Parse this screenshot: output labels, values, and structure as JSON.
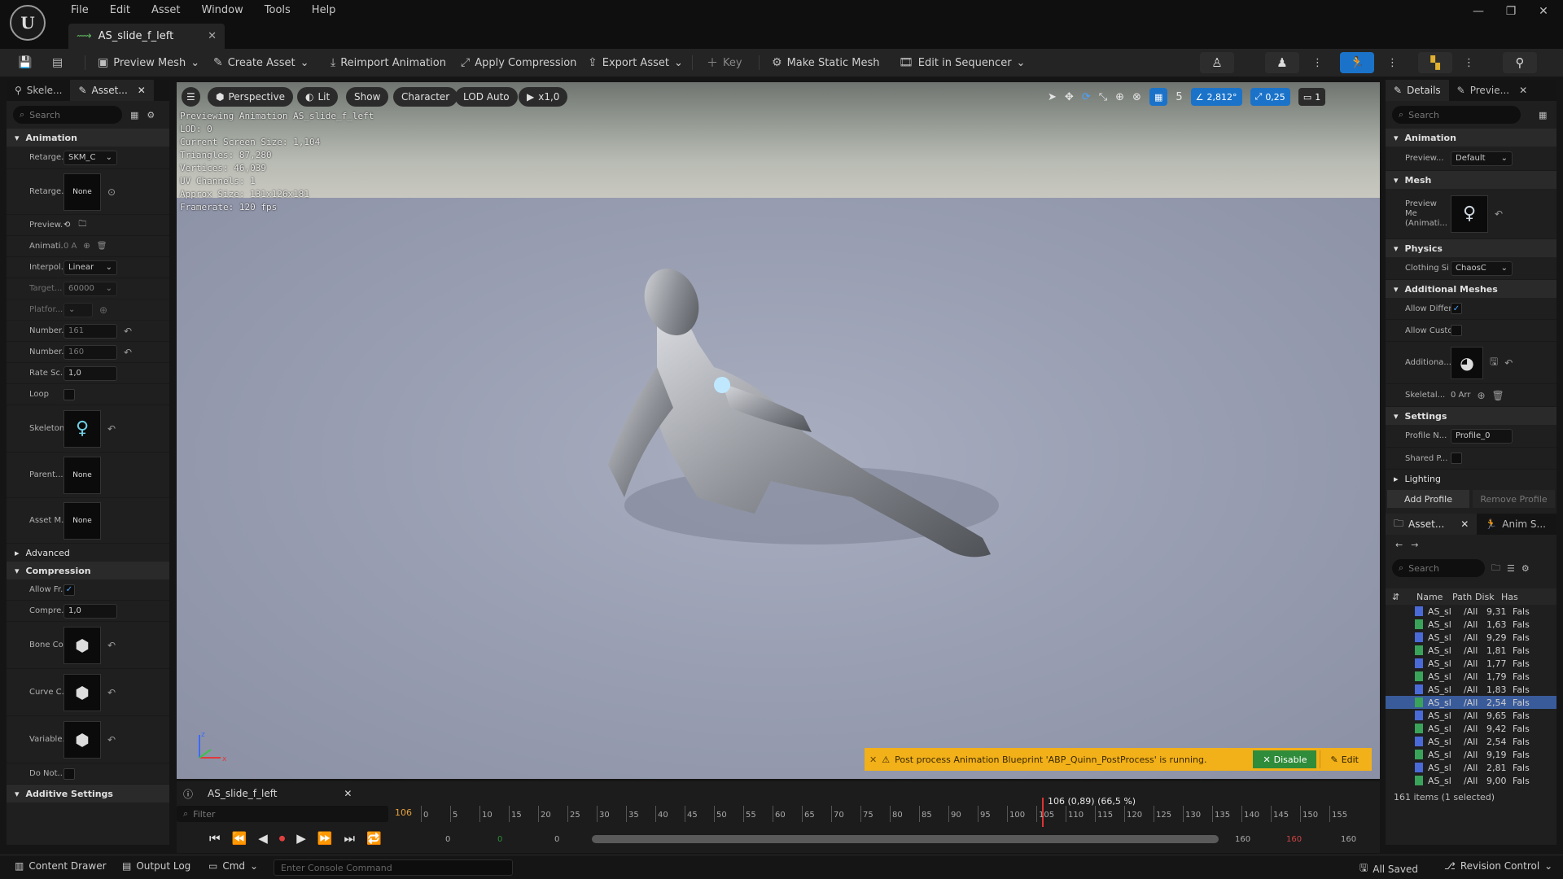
{
  "app": {
    "title": "Unreal Editor"
  },
  "menu": [
    "File",
    "Edit",
    "Asset",
    "Window",
    "Tools",
    "Help"
  ],
  "doc_tab": {
    "label": "AS_slide_f_left"
  },
  "toolbar": {
    "preview_mesh": "Preview Mesh",
    "create_asset": "Create Asset",
    "reimport": "Reimport Animation",
    "apply_compression": "Apply Compression",
    "export_asset": "Export Asset",
    "key": "Key",
    "make_static_mesh": "Make Static Mesh",
    "edit_in_sequencer": "Edit in Sequencer"
  },
  "left": {
    "tabs": [
      "Skele...",
      "Asset..."
    ],
    "search_placeholder": "Search",
    "animation_section": "Animation",
    "rows": [
      {
        "label": "Retarge...",
        "value": "SKM_C"
      },
      {
        "label": "Retarge...",
        "value": "None"
      },
      {
        "label": "Preview...",
        "value": ""
      },
      {
        "label": "Animati...",
        "value": "0 A"
      },
      {
        "label": "Interpol...",
        "value": "Linear"
      },
      {
        "label": "Target...",
        "value": "60000"
      },
      {
        "label": "Platfor...",
        "value": ""
      },
      {
        "label": "Number...",
        "value": "161"
      },
      {
        "label": "Number...",
        "value": "160"
      },
      {
        "label": "Rate Sc...",
        "value": "1,0"
      },
      {
        "label": "Loop",
        "value": ""
      },
      {
        "label": "Skeleton",
        "value": ""
      },
      {
        "label": "Parent...",
        "value": "None"
      },
      {
        "label": "Asset M...",
        "value": "None"
      }
    ],
    "advanced": "Advanced",
    "compression_section": "Compression",
    "compression_rows": [
      {
        "label": "Allow Fr...",
        "value": ""
      },
      {
        "label": "Compre...",
        "value": "1,0"
      },
      {
        "label": "Bone Co...",
        "value": ""
      },
      {
        "label": "Curve C...",
        "value": ""
      },
      {
        "label": "Variable...",
        "value": ""
      },
      {
        "label": "Do Not...",
        "value": ""
      }
    ],
    "additive_section": "Additive Settings"
  },
  "viewport": {
    "perspective": "Perspective",
    "lit": "Lit",
    "show": "Show",
    "character": "Character",
    "lod": "LOD Auto",
    "speed": "x1,0",
    "grid_count": "5",
    "angle": "2,812°",
    "scale": "0,25",
    "camera": "1",
    "stats": [
      "Previewing Animation AS_slide_f_left",
      "LOD: 0",
      "Current Screen Size: 1,104",
      "Triangles: 87,280",
      "Vertices: 46,039",
      "UV Channels: 1",
      "Approx Size: 131x126x181",
      "Framerate: 120 fps"
    ],
    "notification": "Post process Animation Blueprint 'ABP_Quinn_PostProcess' is running.",
    "disable": "Disable",
    "edit": "Edit"
  },
  "timeline": {
    "tab": "AS_slide_f_left",
    "filter_placeholder": "Filter",
    "frame_field": "106",
    "ticks": [
      "0",
      "5",
      "10",
      "15",
      "20",
      "25",
      "30",
      "35",
      "40",
      "45",
      "50",
      "55",
      "60",
      "65",
      "70",
      "75",
      "80",
      "85",
      "90",
      "95",
      "100",
      "105",
      "110",
      "115",
      "120",
      "125",
      "130",
      "135",
      "140",
      "145",
      "150",
      "155"
    ],
    "playhead_label": "106 (0,89) (66,5 %)",
    "playhead_fraction": 0.6625,
    "range_start": "0",
    "range_start2": "0",
    "range_end": "160",
    "range_end2": "160"
  },
  "right": {
    "tabs": [
      "Details",
      "Previe..."
    ],
    "search_placeholder": "Search",
    "sections": {
      "animation": "Animation",
      "mesh": "Mesh",
      "physics": "Physics",
      "additional_meshes": "Additional Meshes",
      "settings": "Settings",
      "lighting": "Lighting"
    },
    "preview_label": "Preview...",
    "preview_value": "Default",
    "preview_mesh_label": "Preview Me (Animati...",
    "clothing_label": "Clothing Si",
    "clothing_value": "ChaosC",
    "allow_diff": "Allow Differ",
    "allow_custom": "Allow Custo",
    "additional_label": "Additiona...",
    "skeletal_label": "Skeletal...",
    "skeletal_value": "0 Arr",
    "profile_label": "Profile N...",
    "profile_value": "Profile_0",
    "shared_label": "Shared P...",
    "add_profile": "Add Profile",
    "remove_profile": "Remove Profile",
    "asset_tabs": [
      "Asset...",
      "Anim S..."
    ],
    "asset_search": "Search",
    "columns": [
      "Name",
      "Path",
      "Disk",
      "Has"
    ],
    "rows": [
      {
        "name": "AS_sl",
        "path": "/All",
        "disk": "9,31",
        "has": "Fals"
      },
      {
        "name": "AS_sl",
        "path": "/All",
        "disk": "1,63",
        "has": "Fals"
      },
      {
        "name": "AS_sl",
        "path": "/All",
        "disk": "9,29",
        "has": "Fals"
      },
      {
        "name": "AS_sl",
        "path": "/All",
        "disk": "1,81",
        "has": "Fals"
      },
      {
        "name": "AS_sl",
        "path": "/All",
        "disk": "1,77",
        "has": "Fals"
      },
      {
        "name": "AS_sl",
        "path": "/All",
        "disk": "1,79",
        "has": "Fals"
      },
      {
        "name": "AS_sl",
        "path": "/All",
        "disk": "1,83",
        "has": "Fals"
      },
      {
        "name": "AS_sl",
        "path": "/All",
        "disk": "2,54",
        "has": "Fals"
      },
      {
        "name": "AS_sl",
        "path": "/All",
        "disk": "9,65",
        "has": "Fals"
      },
      {
        "name": "AS_sl",
        "path": "/All",
        "disk": "9,42",
        "has": "Fals"
      },
      {
        "name": "AS_sl",
        "path": "/All",
        "disk": "2,54",
        "has": "Fals"
      },
      {
        "name": "AS_sl",
        "path": "/All",
        "disk": "9,19",
        "has": "Fals"
      },
      {
        "name": "AS_sl",
        "path": "/All",
        "disk": "2,81",
        "has": "Fals"
      },
      {
        "name": "AS_sl",
        "path": "/All",
        "disk": "9,00",
        "has": "Fals"
      }
    ],
    "selected_index": 7,
    "items_summary": "161 items (1 selected)"
  },
  "status": {
    "content_drawer": "Content Drawer",
    "output_log": "Output Log",
    "cmd": "Cmd",
    "console_placeholder": "Enter Console Command",
    "all_saved": "All Saved",
    "revision": "Revision Control"
  },
  "colors": {
    "accent": "#1a73c9",
    "notify": "#f2b019",
    "disable": "#2f8c3a",
    "selected": "#3a5b9a"
  }
}
